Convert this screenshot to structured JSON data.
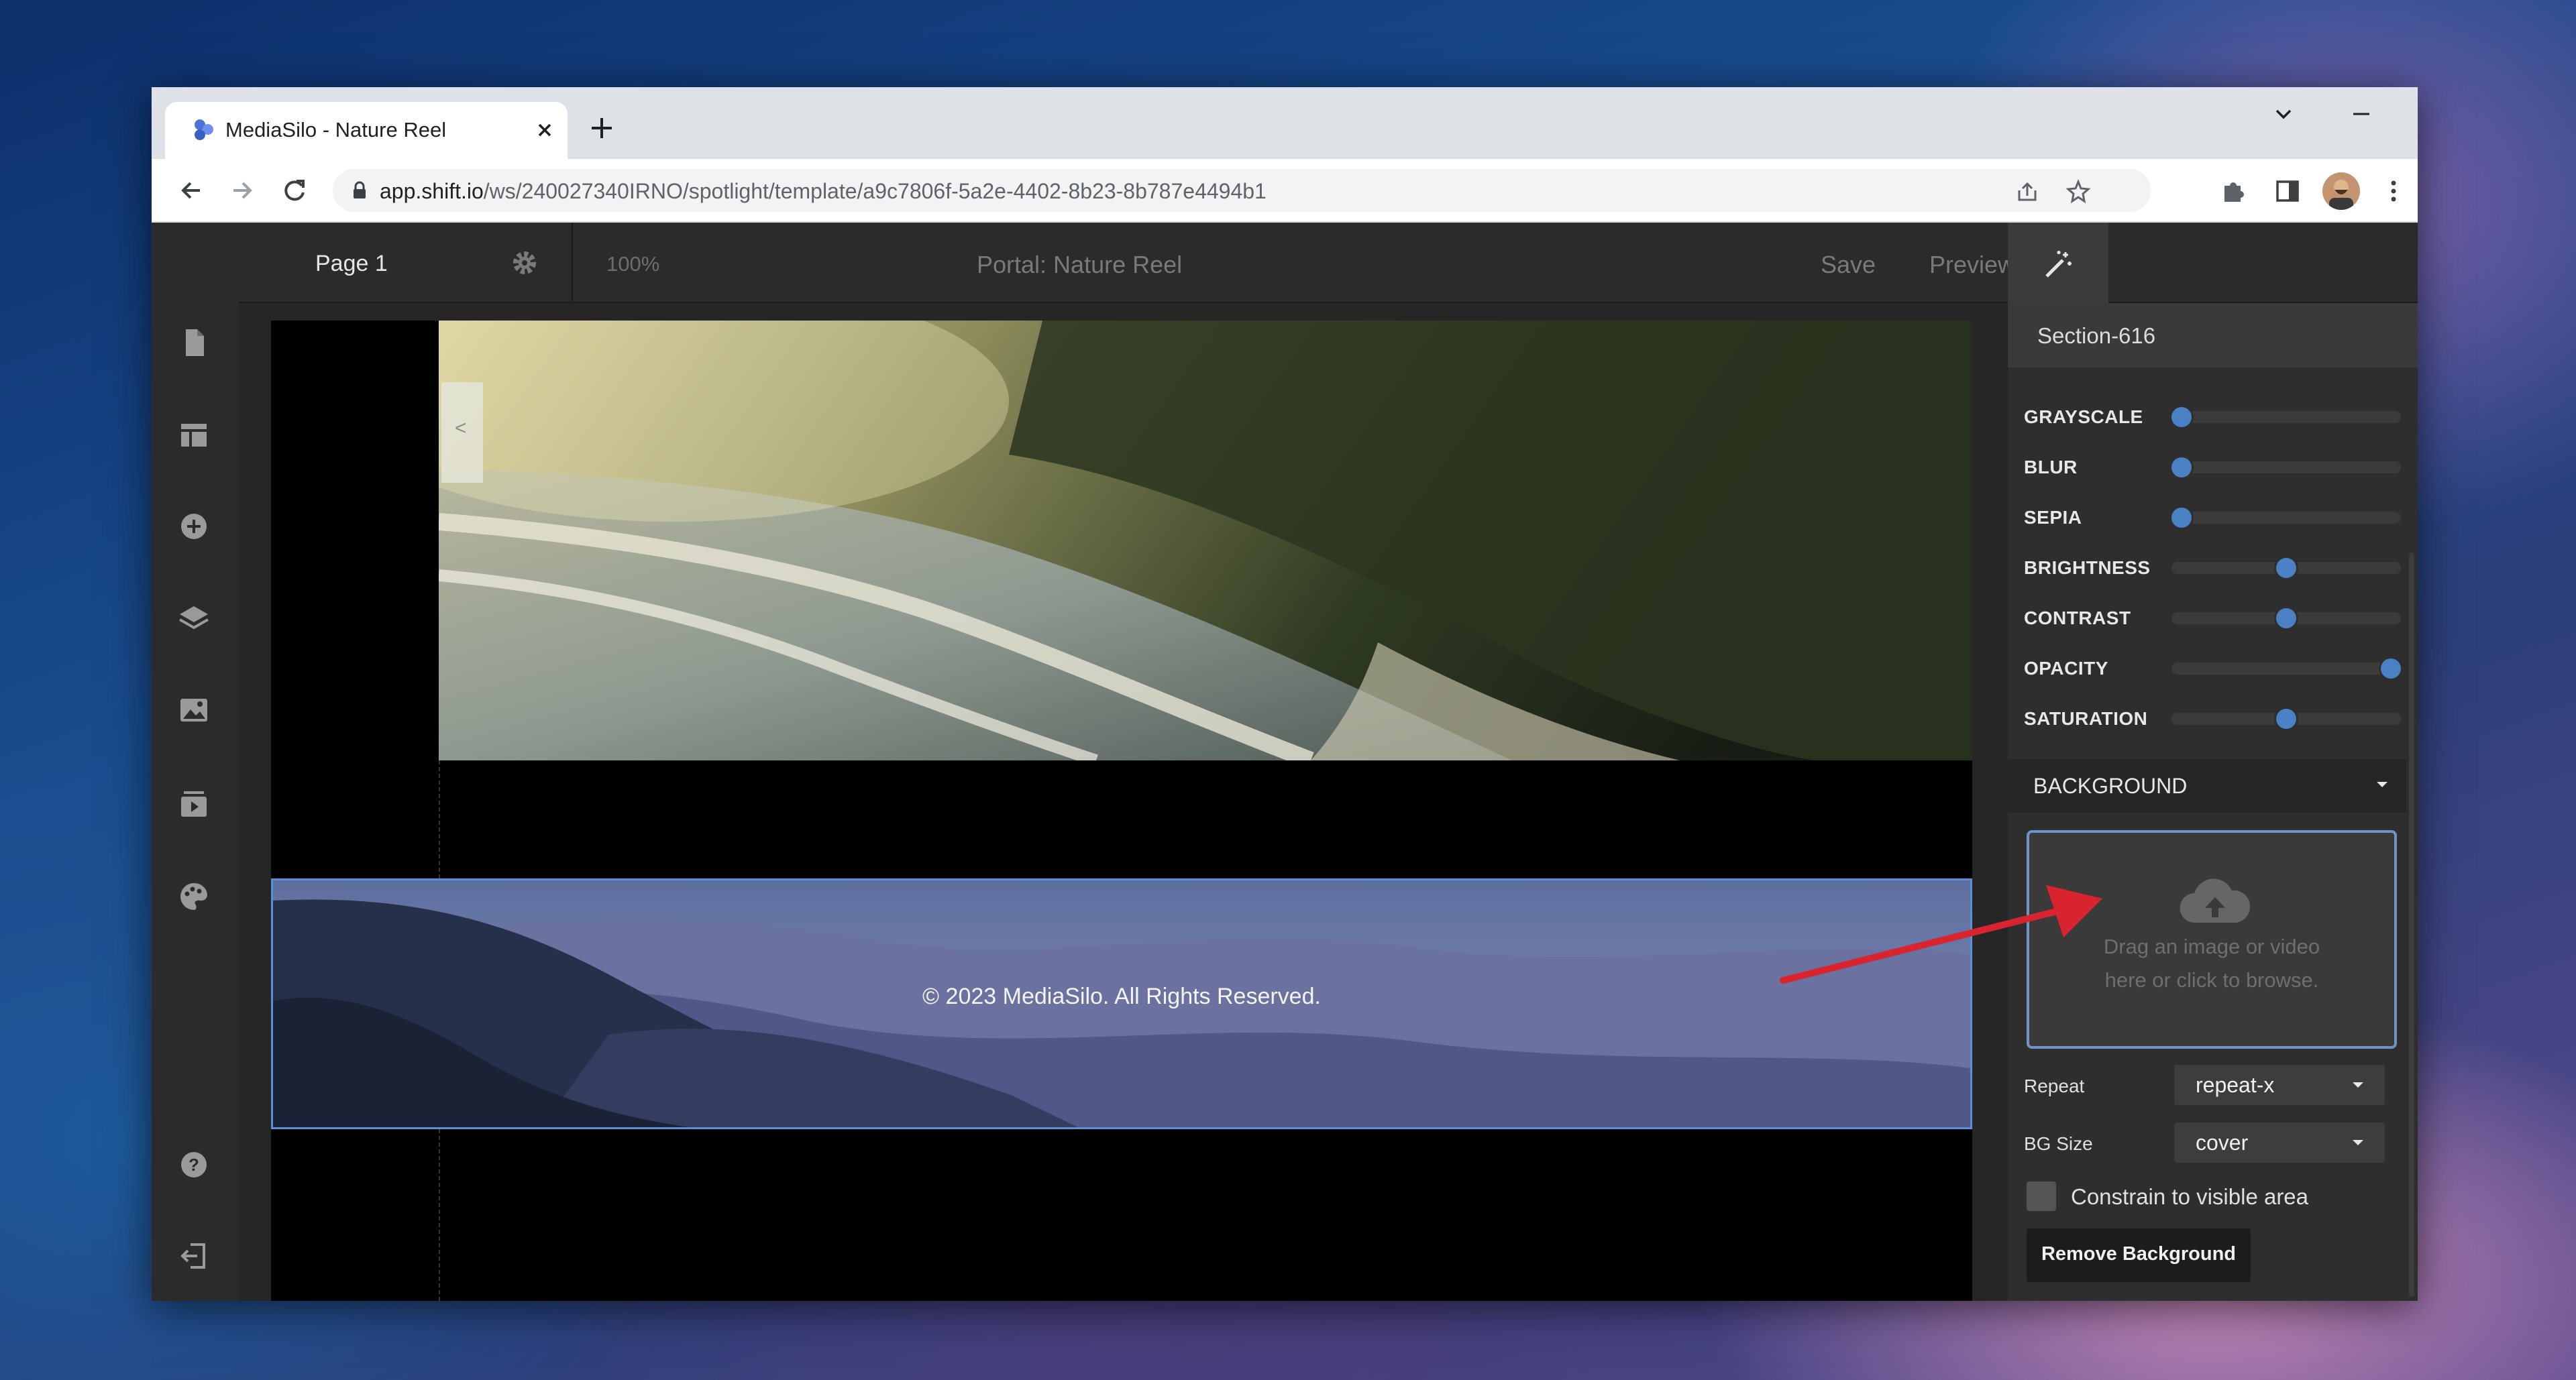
{
  "browser": {
    "tab_title": "MediaSilo - Nature Reel",
    "url_host": "app.shift.io",
    "url_path": "/ws/240027340IRNO/spotlight/template/a9c7806f-5a2e-4402-8b23-8b787e4494b1"
  },
  "editor": {
    "page_label": "Page 1",
    "zoom": "100%",
    "portal_title": "Portal: Nature Reel",
    "save_label": "Save",
    "preview_label": "Preview"
  },
  "left_rail": [
    "pages-icon",
    "layout-icon",
    "add-icon",
    "layers-icon",
    "image-icon",
    "media-icon",
    "palette-icon",
    "help-icon",
    "exit-icon"
  ],
  "canvas": {
    "footer_text": "© 2023 MediaSilo. All Rights Reserved.",
    "collapse_glyph": "<"
  },
  "inspector": {
    "section_name": "Section-616",
    "filters": [
      {
        "label": "GRAYSCALE",
        "value": 0
      },
      {
        "label": "BLUR",
        "value": 0
      },
      {
        "label": "SEPIA",
        "value": 0
      },
      {
        "label": "BRIGHTNESS",
        "value": 0.5
      },
      {
        "label": "CONTRAST",
        "value": 0.5
      },
      {
        "label": "OPACITY",
        "value": 1
      },
      {
        "label": "SATURATION",
        "value": 0.5
      }
    ],
    "background_header": "BACKGROUND",
    "dropzone_line1": "Drag an image or video",
    "dropzone_line2": "here or click to browse.",
    "repeat_label": "Repeat",
    "repeat_value": "repeat-x",
    "bgsize_label": "BG Size",
    "bgsize_value": "cover",
    "constrain_label": "Constrain to visible area",
    "remove_button": "Remove Background"
  },
  "colors": {
    "accent": "#4a80c4",
    "annotation_arrow": "#d9232e",
    "selection": "#5b8fd6"
  }
}
